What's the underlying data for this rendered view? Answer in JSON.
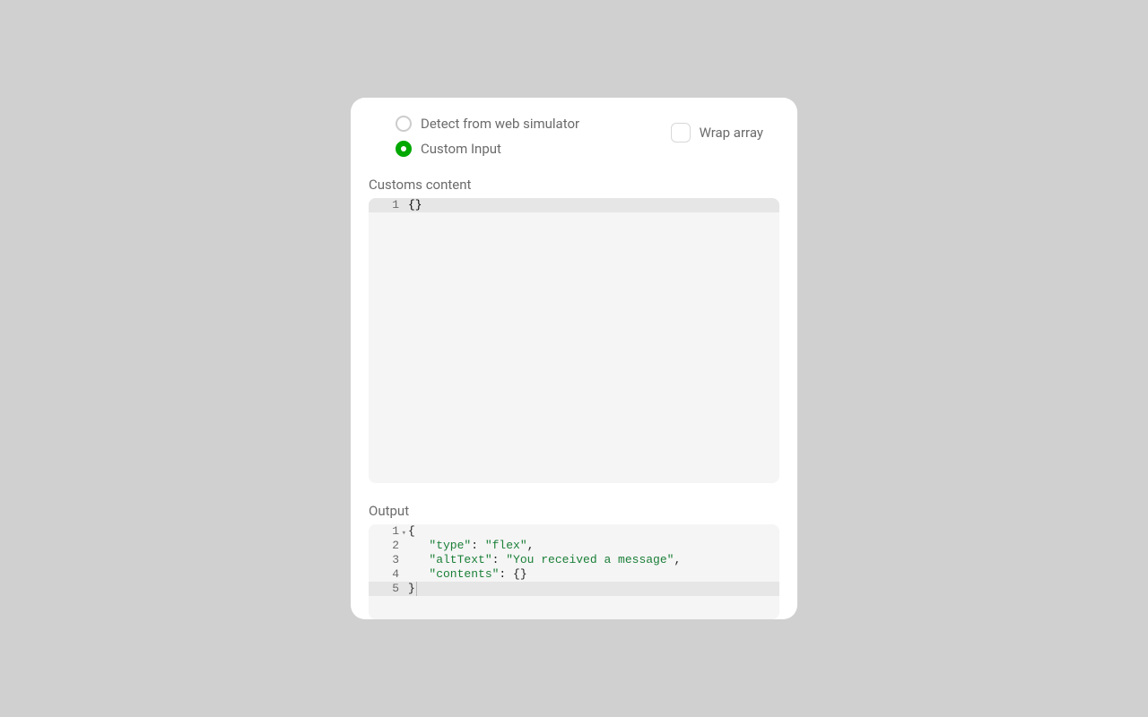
{
  "radios": {
    "detect": {
      "label": "Detect from web simulator",
      "checked": false
    },
    "custom": {
      "label": "Custom Input",
      "checked": true
    }
  },
  "wrap_array": {
    "label": "Wrap array",
    "checked": false
  },
  "customs_section": {
    "label": "Customs content",
    "lines": [
      {
        "num": "1",
        "text": "{}"
      }
    ]
  },
  "output_section": {
    "label": "Output",
    "data": {
      "type": "flex",
      "altText": "You received a message",
      "contents": {}
    },
    "lines": {
      "l1_num": "1",
      "l2_num": "2",
      "l3_num": "3",
      "l4_num": "4",
      "l5_num": "5",
      "l1_brace": "{",
      "l2_key": "\"type\"",
      "l2_val": "\"flex\"",
      "l3_key": "\"altText\"",
      "l3_val": "\"You received a message\"",
      "l4_key": "\"contents\"",
      "l4_val": "{}",
      "l5_brace": "}",
      "colon_space": ": ",
      "comma": ",",
      "indent": "   "
    }
  }
}
